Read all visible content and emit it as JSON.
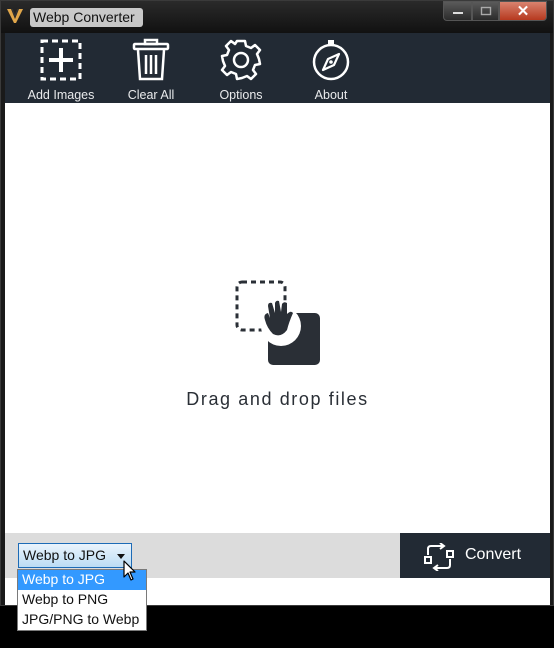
{
  "window": {
    "title": "Webp Converter",
    "close_glyph": "✕"
  },
  "toolbar": {
    "items": [
      {
        "label": "Add Images",
        "icon": "add-image-icon"
      },
      {
        "label": "Clear All",
        "icon": "trash-icon"
      },
      {
        "label": "Options",
        "icon": "gear-icon"
      },
      {
        "label": "About",
        "icon": "compass-icon"
      }
    ]
  },
  "dropzone": {
    "text": "Drag and drop files",
    "icon": "drag-drop-icon"
  },
  "bottom": {
    "format_select": {
      "value": "Webp to JPG"
    },
    "convert_label": "Convert",
    "convert_icon": "convert-arrows-icon"
  },
  "dropdown": {
    "options": [
      "Webp to JPG",
      "Webp to PNG",
      "JPG/PNG to Webp"
    ],
    "selected": "Webp to JPG"
  },
  "colors": {
    "toolbar_bg": "#222a34",
    "accent_selected": "#3399ff",
    "close_button": "#c4472f"
  }
}
